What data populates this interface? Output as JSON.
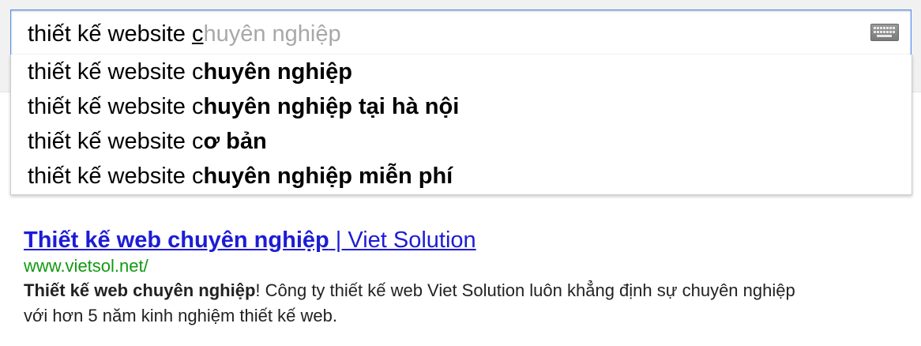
{
  "search": {
    "typed_text": "thiết kế website ",
    "caret_char": "c",
    "ghost_completion": "huyên nghiệp",
    "keyboard_icon": "keyboard-icon"
  },
  "suggestions": [
    {
      "prefix": "thiết kế website c",
      "completion": "huyên nghiệp"
    },
    {
      "prefix": "thiết kế website c",
      "completion": "huyên nghiệp tại hà nội"
    },
    {
      "prefix": "thiết kế website c",
      "completion": "ơ bản"
    },
    {
      "prefix": "thiết kế website c",
      "completion": "huyên nghiệp miễn phí"
    }
  ],
  "result": {
    "title_bold": "Thiết kế web chuyên nghiệp",
    "title_rest": " | Viet Solution",
    "url": "www.vietsol.net/",
    "snippet_bold": "Thiết kế web chuyên nghiệp",
    "snippet_rest": "! Công ty thiết kế web Viet Solution luôn khẳng định sự chuyên nghiệp với hơn 5 năm kinh nghiệm thiết kế web."
  },
  "colors": {
    "link": "#1c1cd6",
    "url_green": "#119911",
    "focus_border": "#4d90fe",
    "ghost_text": "#a8a8a8"
  }
}
